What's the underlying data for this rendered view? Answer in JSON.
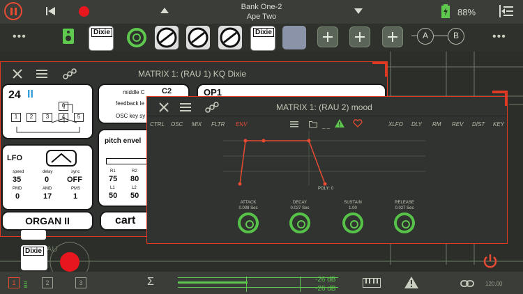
{
  "topbar": {
    "bank_line1": "Bank One-2",
    "bank_line2": "Ape Two",
    "battery": "88%"
  },
  "plugins": [
    {
      "name": "Dixie"
    },
    {
      "name": "Dixie"
    },
    {
      "name": "Dixie"
    }
  ],
  "ab": {
    "a": "A",
    "b": "B"
  },
  "win1": {
    "title": "MATRIX 1: (RAU 1) KQ Dixie",
    "algo": "24",
    "algo_bars": "II",
    "algo_boxes": [
      "1",
      "2",
      "3",
      "4",
      "5",
      "6"
    ],
    "mid": {
      "middle_c": "middle C",
      "c2": "C2",
      "feedback": "feedback le",
      "osc_key": "OSC key sy"
    },
    "lfo": {
      "title": "LFO",
      "speed_l": "speed",
      "speed": "35",
      "delay_l": "delay",
      "delay": "0",
      "sync_l": "sync",
      "sync": "OFF",
      "pmd_l": "PMD",
      "pmd": "0",
      "amd_l": "AMD",
      "amd": "17",
      "pms_l": "PMS",
      "pms": "1"
    },
    "pitch": {
      "title": "pitch envel",
      "r1_l": "R1",
      "r1": "75",
      "r2_l": "R2",
      "r2": "80",
      "l1_l": "L1",
      "l1": "50",
      "l2_l": "L2",
      "l2": "50"
    },
    "organ": "ORGAN II",
    "cart": "cart",
    "op": "OP1"
  },
  "win2": {
    "title": "MATRIX 1: (RAU 2) mood",
    "tabs_left": [
      "CTRL",
      "OSC",
      "MIX",
      "FLTR",
      "ENV"
    ],
    "tabs_right": [
      "XLFO",
      "DLY",
      "RM",
      "REV",
      "DIST",
      "KEY"
    ],
    "poly": "POLY: 0",
    "knobs": [
      {
        "label": "ATTACK",
        "value": "0.008 Sec"
      },
      {
        "label": "DECAY",
        "value": "0.027 Sec"
      },
      {
        "label": "SUSTAIN",
        "value": "1.00"
      },
      {
        "label": "RELEASE",
        "value": "0.027 Sec"
      }
    ]
  },
  "bottom": {
    "db1": "-26 dB",
    "db2": "-26 dB",
    "bpm": "120.00"
  },
  "misc": {
    "dixie": "Dixie",
    "au": "AU",
    "n1": "1",
    "n2": "2",
    "n3": "3"
  }
}
